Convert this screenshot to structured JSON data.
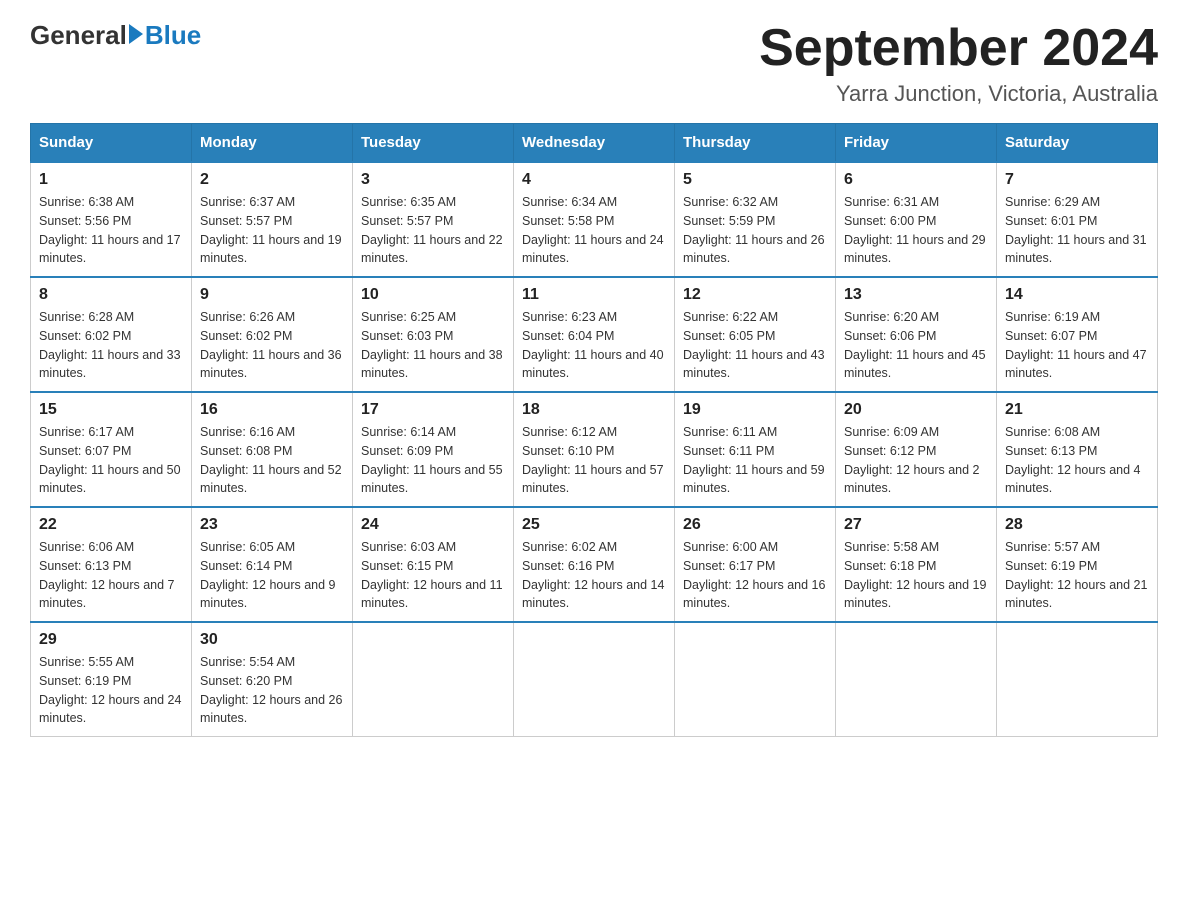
{
  "header": {
    "logo_general": "General",
    "logo_blue": "Blue",
    "month_year": "September 2024",
    "location": "Yarra Junction, Victoria, Australia"
  },
  "days_of_week": [
    "Sunday",
    "Monday",
    "Tuesday",
    "Wednesday",
    "Thursday",
    "Friday",
    "Saturday"
  ],
  "weeks": [
    [
      {
        "day": 1,
        "sunrise": "6:38 AM",
        "sunset": "5:56 PM",
        "daylight": "11 hours and 17 minutes."
      },
      {
        "day": 2,
        "sunrise": "6:37 AM",
        "sunset": "5:57 PM",
        "daylight": "11 hours and 19 minutes."
      },
      {
        "day": 3,
        "sunrise": "6:35 AM",
        "sunset": "5:57 PM",
        "daylight": "11 hours and 22 minutes."
      },
      {
        "day": 4,
        "sunrise": "6:34 AM",
        "sunset": "5:58 PM",
        "daylight": "11 hours and 24 minutes."
      },
      {
        "day": 5,
        "sunrise": "6:32 AM",
        "sunset": "5:59 PM",
        "daylight": "11 hours and 26 minutes."
      },
      {
        "day": 6,
        "sunrise": "6:31 AM",
        "sunset": "6:00 PM",
        "daylight": "11 hours and 29 minutes."
      },
      {
        "day": 7,
        "sunrise": "6:29 AM",
        "sunset": "6:01 PM",
        "daylight": "11 hours and 31 minutes."
      }
    ],
    [
      {
        "day": 8,
        "sunrise": "6:28 AM",
        "sunset": "6:02 PM",
        "daylight": "11 hours and 33 minutes."
      },
      {
        "day": 9,
        "sunrise": "6:26 AM",
        "sunset": "6:02 PM",
        "daylight": "11 hours and 36 minutes."
      },
      {
        "day": 10,
        "sunrise": "6:25 AM",
        "sunset": "6:03 PM",
        "daylight": "11 hours and 38 minutes."
      },
      {
        "day": 11,
        "sunrise": "6:23 AM",
        "sunset": "6:04 PM",
        "daylight": "11 hours and 40 minutes."
      },
      {
        "day": 12,
        "sunrise": "6:22 AM",
        "sunset": "6:05 PM",
        "daylight": "11 hours and 43 minutes."
      },
      {
        "day": 13,
        "sunrise": "6:20 AM",
        "sunset": "6:06 PM",
        "daylight": "11 hours and 45 minutes."
      },
      {
        "day": 14,
        "sunrise": "6:19 AM",
        "sunset": "6:07 PM",
        "daylight": "11 hours and 47 minutes."
      }
    ],
    [
      {
        "day": 15,
        "sunrise": "6:17 AM",
        "sunset": "6:07 PM",
        "daylight": "11 hours and 50 minutes."
      },
      {
        "day": 16,
        "sunrise": "6:16 AM",
        "sunset": "6:08 PM",
        "daylight": "11 hours and 52 minutes."
      },
      {
        "day": 17,
        "sunrise": "6:14 AM",
        "sunset": "6:09 PM",
        "daylight": "11 hours and 55 minutes."
      },
      {
        "day": 18,
        "sunrise": "6:12 AM",
        "sunset": "6:10 PM",
        "daylight": "11 hours and 57 minutes."
      },
      {
        "day": 19,
        "sunrise": "6:11 AM",
        "sunset": "6:11 PM",
        "daylight": "11 hours and 59 minutes."
      },
      {
        "day": 20,
        "sunrise": "6:09 AM",
        "sunset": "6:12 PM",
        "daylight": "12 hours and 2 minutes."
      },
      {
        "day": 21,
        "sunrise": "6:08 AM",
        "sunset": "6:13 PM",
        "daylight": "12 hours and 4 minutes."
      }
    ],
    [
      {
        "day": 22,
        "sunrise": "6:06 AM",
        "sunset": "6:13 PM",
        "daylight": "12 hours and 7 minutes."
      },
      {
        "day": 23,
        "sunrise": "6:05 AM",
        "sunset": "6:14 PM",
        "daylight": "12 hours and 9 minutes."
      },
      {
        "day": 24,
        "sunrise": "6:03 AM",
        "sunset": "6:15 PM",
        "daylight": "12 hours and 11 minutes."
      },
      {
        "day": 25,
        "sunrise": "6:02 AM",
        "sunset": "6:16 PM",
        "daylight": "12 hours and 14 minutes."
      },
      {
        "day": 26,
        "sunrise": "6:00 AM",
        "sunset": "6:17 PM",
        "daylight": "12 hours and 16 minutes."
      },
      {
        "day": 27,
        "sunrise": "5:58 AM",
        "sunset": "6:18 PM",
        "daylight": "12 hours and 19 minutes."
      },
      {
        "day": 28,
        "sunrise": "5:57 AM",
        "sunset": "6:19 PM",
        "daylight": "12 hours and 21 minutes."
      }
    ],
    [
      {
        "day": 29,
        "sunrise": "5:55 AM",
        "sunset": "6:19 PM",
        "daylight": "12 hours and 24 minutes."
      },
      {
        "day": 30,
        "sunrise": "5:54 AM",
        "sunset": "6:20 PM",
        "daylight": "12 hours and 26 minutes."
      },
      null,
      null,
      null,
      null,
      null
    ]
  ]
}
